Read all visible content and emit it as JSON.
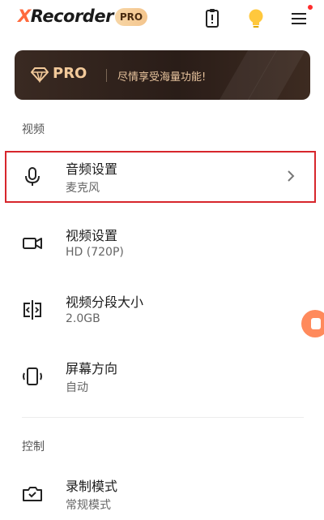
{
  "header": {
    "app_name_x": "X",
    "app_name_rest": "Recorder",
    "pro_badge": "PRO"
  },
  "banner": {
    "pro_label": "PRO",
    "tagline": "尽情享受海量功能!"
  },
  "sections": {
    "video_label": "视频",
    "control_label": "控制"
  },
  "items": [
    {
      "title": "音频设置",
      "subtitle": "麦克风",
      "icon": "microphone-icon"
    },
    {
      "title": "视频设置",
      "subtitle": "HD (720P)",
      "icon": "video-camera-icon"
    },
    {
      "title": "视频分段大小",
      "subtitle": "2.0GB",
      "icon": "split-icon"
    },
    {
      "title": "屏幕方向",
      "subtitle": "自动",
      "icon": "screen-rotation-icon"
    },
    {
      "title": "录制模式",
      "subtitle": "常规模式",
      "icon": "record-mode-icon"
    }
  ],
  "colors": {
    "accent": "#ff6a3d",
    "highlight_border": "#d7262c",
    "banner_text": "#f2c99a",
    "bulb": "#ffc83d"
  }
}
